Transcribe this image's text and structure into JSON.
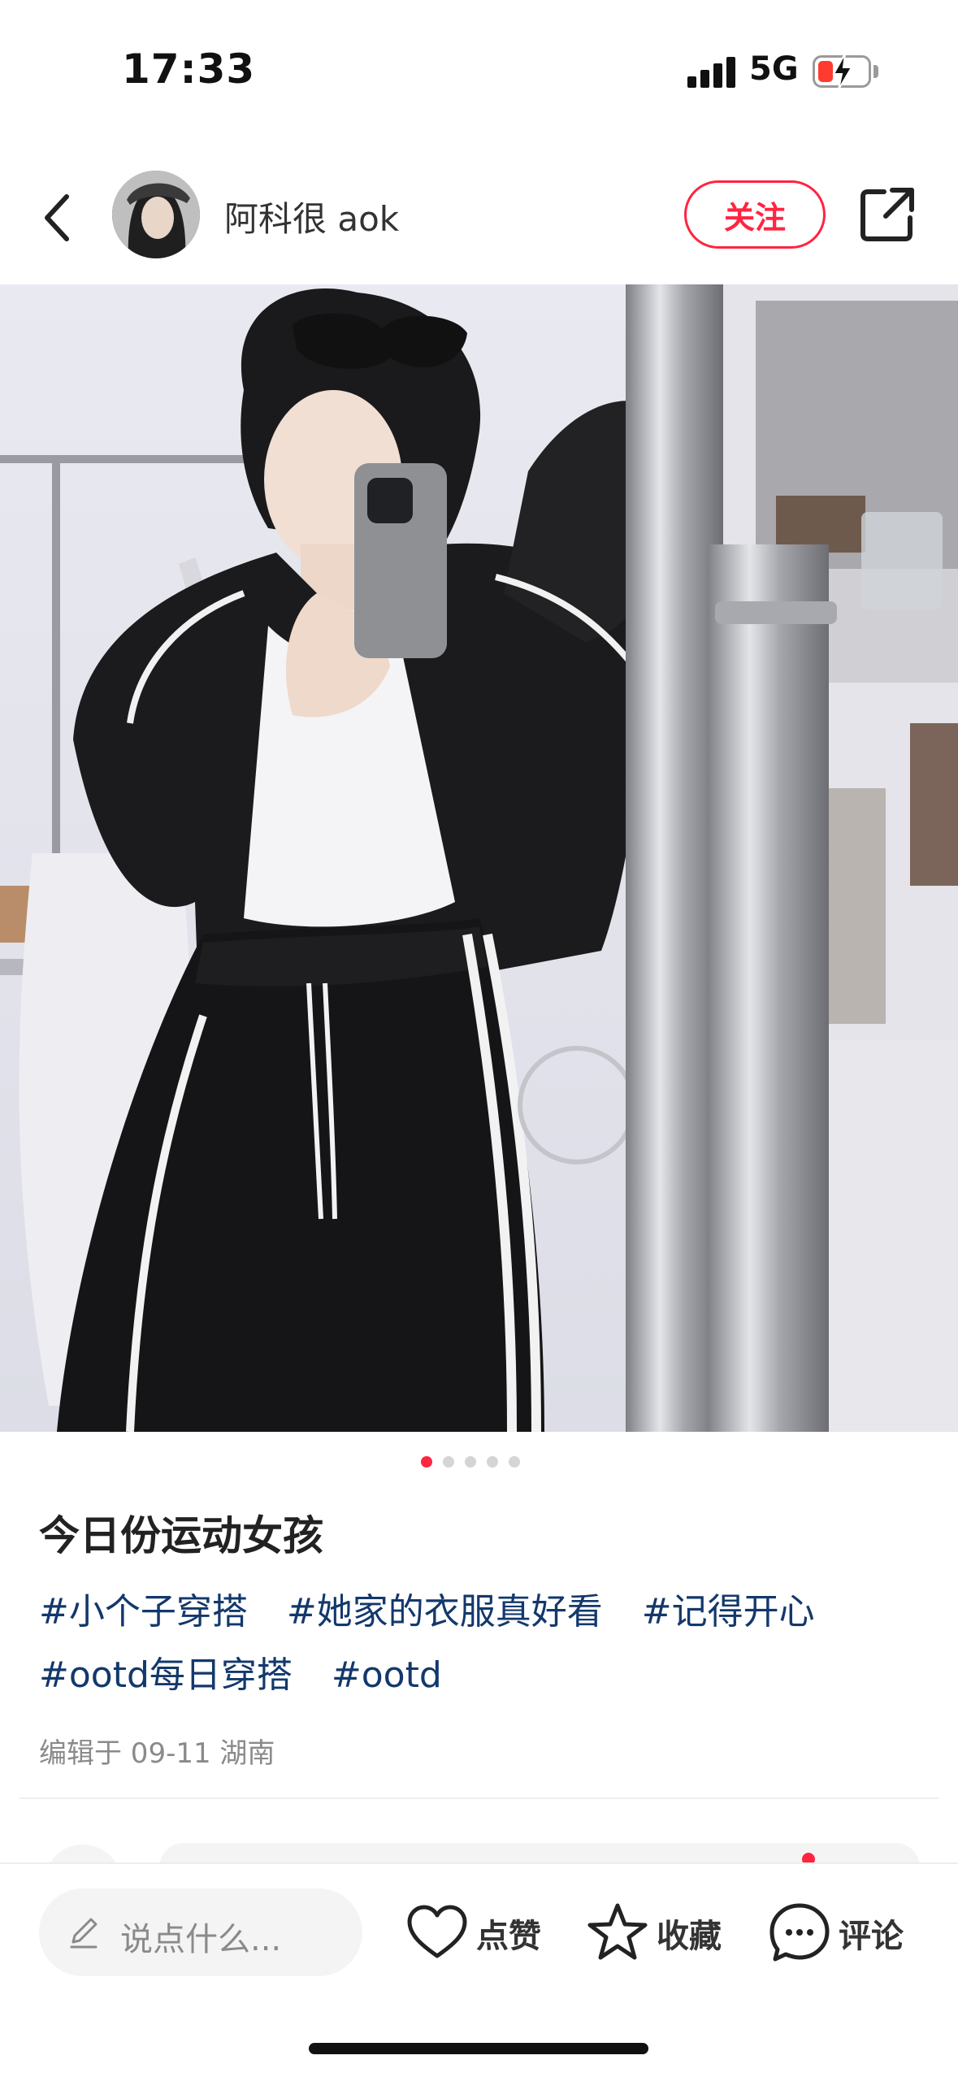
{
  "status_bar": {
    "time": "17:33",
    "network": "5G",
    "battery_color": "#ff3b30"
  },
  "header": {
    "author_name": "阿科很 aok",
    "follow_label": "关注",
    "accent_color": "#ff2442"
  },
  "carousel": {
    "total": 5,
    "active_index": 0
  },
  "note": {
    "title": "今日份运动女孩",
    "tags": [
      "#小个子穿搭",
      "#她家的衣服真好看",
      "#记得开心",
      "#ootd每日穿搭",
      "#ootd"
    ],
    "meta": "编辑于 09-11 湖南"
  },
  "bottom_bar": {
    "input_placeholder": "说点什么...",
    "like_label": "点赞",
    "collect_label": "收藏",
    "comment_label": "评论"
  },
  "icons": {
    "back": "back-arrow-icon",
    "share": "share-icon",
    "pencil": "pencil-icon",
    "like": "heart-icon",
    "collect": "star-icon",
    "comment": "comment-bubble-icon"
  }
}
